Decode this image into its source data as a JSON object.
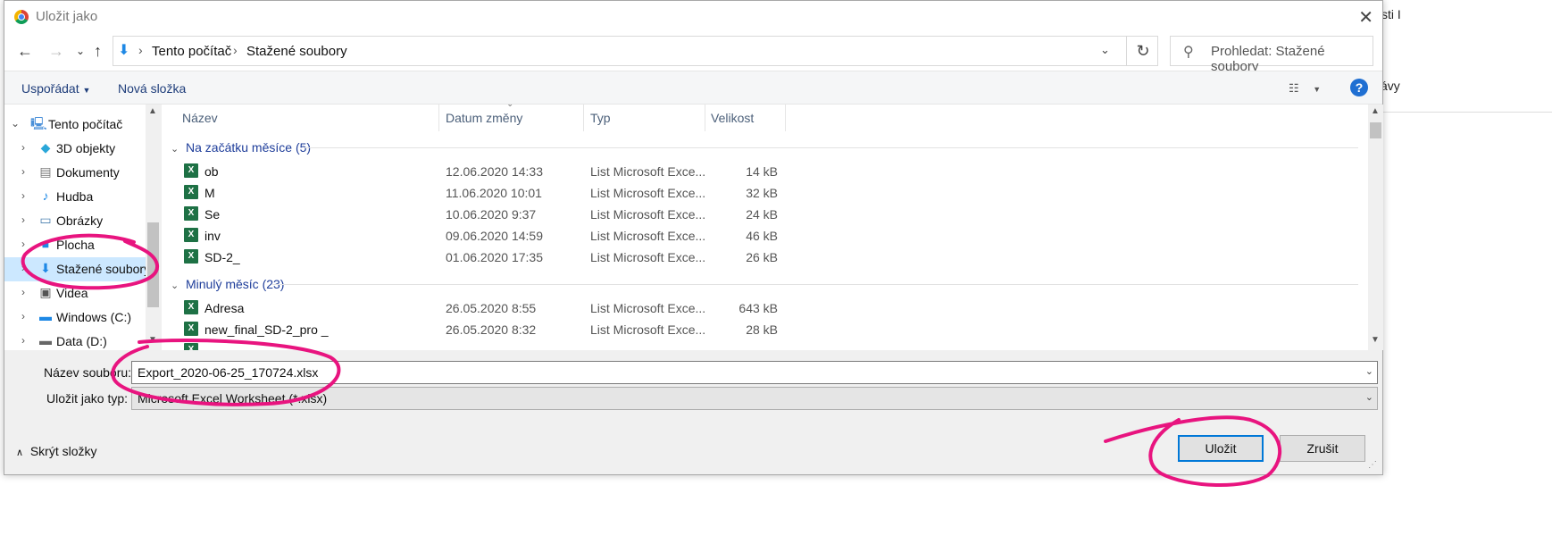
{
  "background": {
    "tab_text": "sti I",
    "side_text": "ávy"
  },
  "dialog": {
    "title": "Uložit jako",
    "close_label": "✕"
  },
  "address_bar": {
    "segments": [
      "Tento počítač",
      "Stažené soubory"
    ]
  },
  "search": {
    "placeholder": "Prohledat: Stažené soubory"
  },
  "toolbar": {
    "organize": "Uspořádat",
    "new_folder": "Nová složka",
    "help": "?"
  },
  "tree": {
    "items": [
      {
        "label": "Tento počítač",
        "icon": "pc-icon"
      },
      {
        "label": "3D objekty",
        "icon": "3d-objects-icon"
      },
      {
        "label": "Dokumenty",
        "icon": "documents-icon"
      },
      {
        "label": "Hudba",
        "icon": "music-icon"
      },
      {
        "label": "Obrázky",
        "icon": "pictures-icon"
      },
      {
        "label": "Plocha",
        "icon": "desktop-icon"
      },
      {
        "label": "Stažené soubory",
        "icon": "downloads-icon",
        "selected": true
      },
      {
        "label": "Videa",
        "icon": "videos-icon"
      },
      {
        "label": "Windows (C:)",
        "icon": "drive-icon"
      },
      {
        "label": "Data (D:)",
        "icon": "drive-icon"
      }
    ]
  },
  "columns": [
    "Název",
    "Datum změny",
    "Typ",
    "Velikost"
  ],
  "groups": [
    {
      "label": "Na začátku měsíce (5)",
      "files": [
        {
          "name": "ob",
          "date": "12.06.2020 14:33",
          "type": "List Microsoft Exce...",
          "size": "14 kB"
        },
        {
          "name": "M",
          "date": "11.06.2020 10:01",
          "type": "List Microsoft Exce...",
          "size": "32 kB"
        },
        {
          "name": "Se",
          "date": "10.06.2020 9:37",
          "type": "List Microsoft Exce...",
          "size": "24 kB"
        },
        {
          "name": "inv",
          "date": "09.06.2020 14:59",
          "type": "List Microsoft Exce...",
          "size": "46 kB"
        },
        {
          "name": "SD-2_",
          "date": "01.06.2020 17:35",
          "type": "List Microsoft Exce...",
          "size": "26 kB"
        }
      ]
    },
    {
      "label": "Minulý měsíc (23)",
      "files": [
        {
          "name": "Adresa",
          "date": "26.05.2020 8:55",
          "type": "List Microsoft Exce...",
          "size": "643 kB"
        },
        {
          "name": "new_final_SD-2_pro _",
          "date": "26.05.2020 8:32",
          "type": "List Microsoft Exce...",
          "size": "28 kB"
        }
      ]
    }
  ],
  "form": {
    "filename_label": "Název souboru:",
    "filename_value": "Export_2020-06-25_170724.xlsx",
    "filetype_label": "Uložit jako typ:",
    "filetype_value": "Microsoft Excel Worksheet (*.xlsx)"
  },
  "footer": {
    "hide_folders": "Skrýt složky",
    "save": "Uložit",
    "cancel": "Zrušit"
  },
  "colors": {
    "annotation": "#e8147f",
    "selection": "#cce8ff",
    "group_header": "#1e3d9a"
  }
}
